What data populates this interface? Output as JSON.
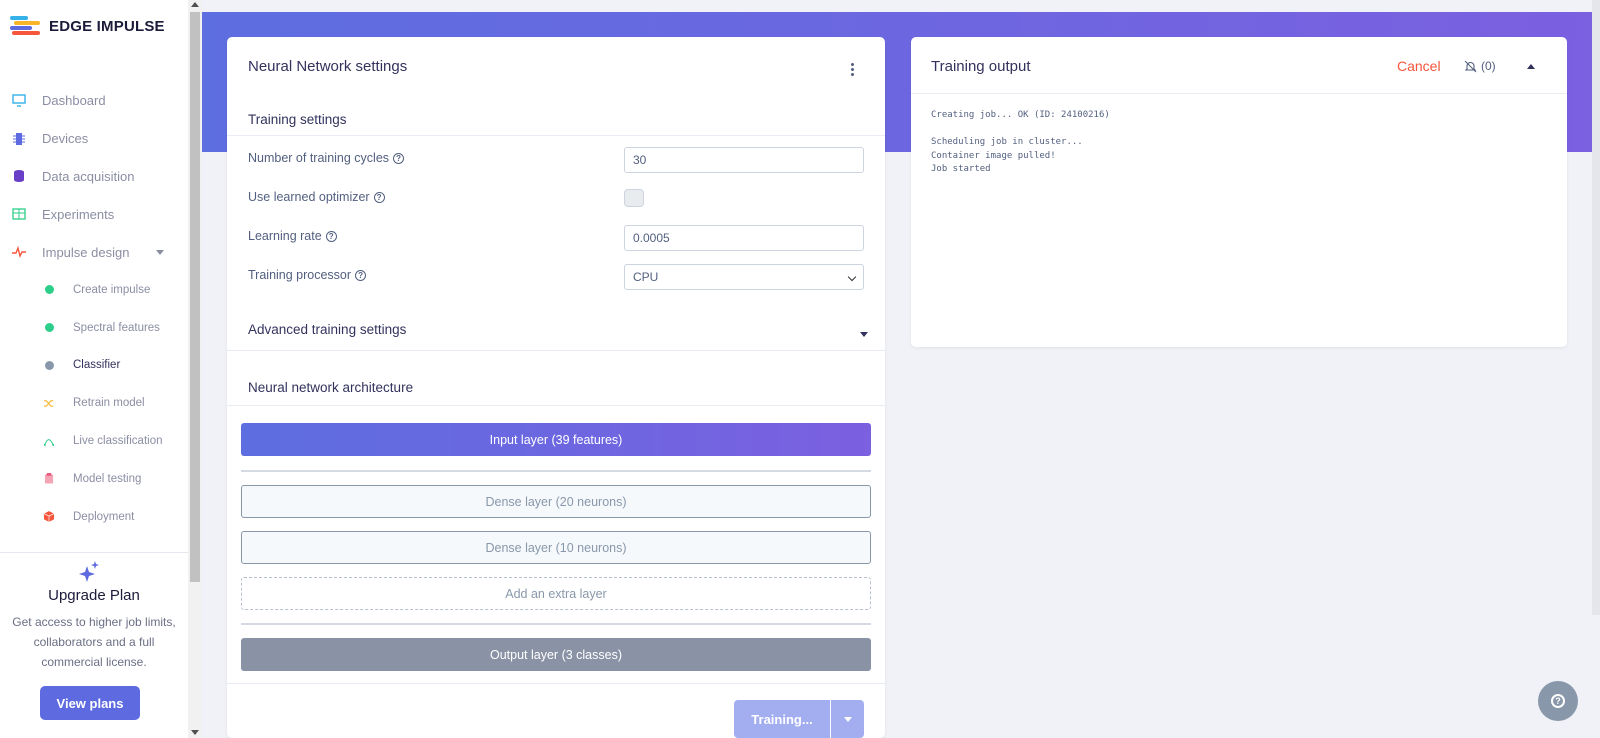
{
  "app": {
    "name": "EDGE IMPULSE"
  },
  "colors": {
    "accent": "#5d6ae0",
    "danger": "#f5563c",
    "gradient_start": "#5d6ee0",
    "gradient_end": "#7b60e0"
  },
  "sidebar": {
    "items": [
      {
        "label": "Dashboard",
        "icon": "monitor-icon"
      },
      {
        "label": "Devices",
        "icon": "chip-icon"
      },
      {
        "label": "Data acquisition",
        "icon": "database-icon"
      },
      {
        "label": "Experiments",
        "icon": "table-icon"
      },
      {
        "label": "Impulse design",
        "icon": "pulse-icon"
      }
    ],
    "sub_items": [
      {
        "label": "Create impulse",
        "icon": "dot-green"
      },
      {
        "label": "Spectral features",
        "icon": "dot-green"
      },
      {
        "label": "Classifier",
        "icon": "dot-gray"
      },
      {
        "label": "Retrain model",
        "icon": "shuffle-icon"
      },
      {
        "label": "Live classification",
        "icon": "curve-icon"
      },
      {
        "label": "Model testing",
        "icon": "clipboard-icon"
      },
      {
        "label": "Deployment",
        "icon": "box-icon"
      }
    ],
    "upgrade": {
      "title": "Upgrade Plan",
      "description": "Get access to higher job limits, collaborators and a full commercial license.",
      "button": "View plans"
    }
  },
  "nn_settings": {
    "title": "Neural Network settings",
    "training_settings": {
      "title": "Training settings",
      "cycles_label": "Number of training cycles",
      "cycles_value": "30",
      "optimizer_label": "Use learned optimizer",
      "optimizer_checked": false,
      "lr_label": "Learning rate",
      "lr_value": "0.0005",
      "processor_label": "Training processor",
      "processor_value": "CPU"
    },
    "advanced_title": "Advanced training settings",
    "architecture": {
      "title": "Neural network architecture",
      "input_layer": "Input layer (39 features)",
      "dense_1": "Dense layer (20 neurons)",
      "dense_2": "Dense layer (10 neurons)",
      "add_layer": "Add an extra layer",
      "output_layer": "Output layer (3 classes)"
    },
    "train_button": "Training..."
  },
  "training_output": {
    "title": "Training output",
    "cancel": "Cancel",
    "notifications": "(0)",
    "log": "Creating job... OK (ID: 24100216)\n\nScheduling job in cluster...\nContainer image pulled!\nJob started"
  },
  "help_fab": "?"
}
